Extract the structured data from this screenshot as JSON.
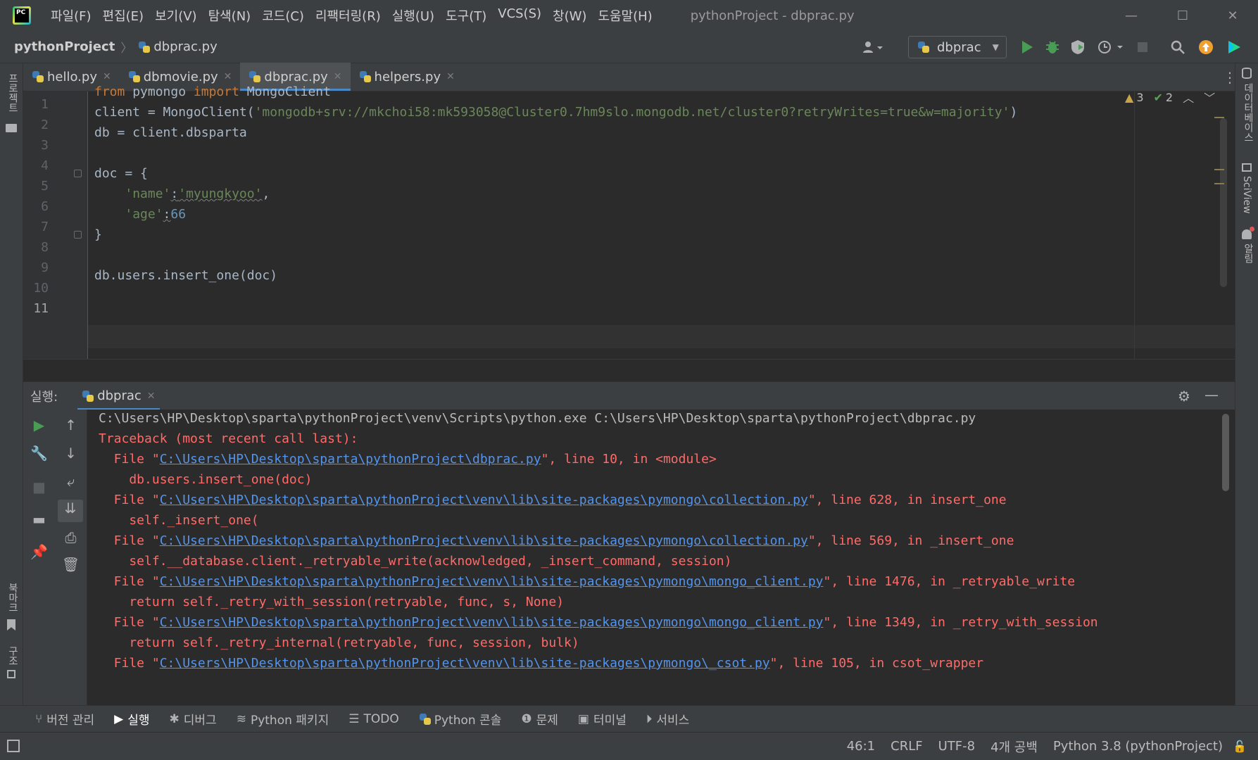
{
  "window": {
    "title": "pythonProject - dbprac.py",
    "menu": [
      "파일(F)",
      "편집(E)",
      "보기(V)",
      "탐색(N)",
      "코드(C)",
      "리팩터링(R)",
      "실행(U)",
      "도구(T)",
      "VCS(S)",
      "창(W)",
      "도움말(H)"
    ],
    "minimize": "—",
    "maximize": "☐",
    "close": "✕"
  },
  "navbar": {
    "project": "pythonProject",
    "file": "dbprac.py",
    "run_config": "dbprac"
  },
  "left_strip": {
    "top": "프로젝트",
    "bottom1": "북마크",
    "bottom2": "구조"
  },
  "right_strip": {
    "db": "데이터베이스",
    "sciview": "SciView",
    "notif": "알림"
  },
  "tabs": [
    {
      "label": "hello.py"
    },
    {
      "label": "dbmovie.py"
    },
    {
      "label": "dbprac.py",
      "active": true
    },
    {
      "label": "helpers.py"
    }
  ],
  "editor": {
    "line_numbers": [
      "1",
      "2",
      "3",
      "4",
      "5",
      "6",
      "7",
      "8",
      "9",
      "10",
      "11"
    ],
    "current_line": "11",
    "warnings": "3",
    "ok_count": "2",
    "code": {
      "l1_from": "from",
      "l1_mod": " pymongo ",
      "l1_import": "import",
      "l1_cls": " MongoClient",
      "l2_pre": "client = MongoClient(",
      "l2_str": "'mongodb+srv://mkchoi58:mk593058@Cluster0.7hm9slo.mongodb.net/cluster0?retryWrites=true&w=majority'",
      "l2_post": ")",
      "l3": "db = client.dbsparta",
      "l5": "doc = {",
      "l6_key": "'name'",
      "l6_colon": ":",
      "l6_val": "'myungkyoo'",
      "l6_comma": ",",
      "l7_key": "'age'",
      "l7_colon": ":",
      "l7_val": "66",
      "l8": "}",
      "l10": "db.users.insert_one(doc)"
    }
  },
  "run_panel": {
    "label": "실행:",
    "tab": "dbprac",
    "lines": [
      {
        "type": "cmd",
        "text": "C:\\Users\\HP\\Desktop\\sparta\\pythonProject\\venv\\Scripts\\python.exe C:\\Users\\HP\\Desktop\\sparta\\pythonProject\\dbprac.py"
      },
      {
        "type": "err",
        "text": "Traceback (most recent call last):"
      },
      {
        "type": "file",
        "pre": "  File \"",
        "link": "C:\\Users\\HP\\Desktop\\sparta\\pythonProject\\dbprac.py",
        "post": "\", line 10, in <module>"
      },
      {
        "type": "err",
        "text": "    db.users.insert_one(doc)"
      },
      {
        "type": "file",
        "pre": "  File \"",
        "link": "C:\\Users\\HP\\Desktop\\sparta\\pythonProject\\venv\\lib\\site-packages\\pymongo\\collection.py",
        "post": "\", line 628, in insert_one"
      },
      {
        "type": "err",
        "text": "    self._insert_one("
      },
      {
        "type": "file",
        "pre": "  File \"",
        "link": "C:\\Users\\HP\\Desktop\\sparta\\pythonProject\\venv\\lib\\site-packages\\pymongo\\collection.py",
        "post": "\", line 569, in _insert_one"
      },
      {
        "type": "err",
        "text": "    self.__database.client._retryable_write(acknowledged, _insert_command, session)"
      },
      {
        "type": "file",
        "pre": "  File \"",
        "link": "C:\\Users\\HP\\Desktop\\sparta\\pythonProject\\venv\\lib\\site-packages\\pymongo\\mongo_client.py",
        "post": "\", line 1476, in _retryable_write"
      },
      {
        "type": "err",
        "text": "    return self._retry_with_session(retryable, func, s, None)"
      },
      {
        "type": "file",
        "pre": "  File \"",
        "link": "C:\\Users\\HP\\Desktop\\sparta\\pythonProject\\venv\\lib\\site-packages\\pymongo\\mongo_client.py",
        "post": "\", line 1349, in _retry_with_session"
      },
      {
        "type": "err",
        "text": "    return self._retry_internal(retryable, func, session, bulk)"
      },
      {
        "type": "file",
        "pre": "  File \"",
        "link": "C:\\Users\\HP\\Desktop\\sparta\\pythonProject\\venv\\lib\\site-packages\\pymongo\\_csot.py",
        "post": "\", line 105, in csot_wrapper"
      }
    ]
  },
  "bottom_tools": [
    "버전 관리",
    "실행",
    "디버그",
    "Python 패키지",
    "TODO",
    "Python 콘솔",
    "문제",
    "터미널",
    "서비스"
  ],
  "status": {
    "position": "46:1",
    "line_sep": "CRLF",
    "encoding": "UTF-8",
    "indent": "4개 공백",
    "interpreter": "Python 3.8 (pythonProject)"
  },
  "colors": {
    "keyword": "#cc7832",
    "string": "#6a8759",
    "number": "#6897bb",
    "error": "#ff6b68",
    "link": "#5394ec",
    "accent": "#4a88c7",
    "run_green": "#499c54"
  }
}
